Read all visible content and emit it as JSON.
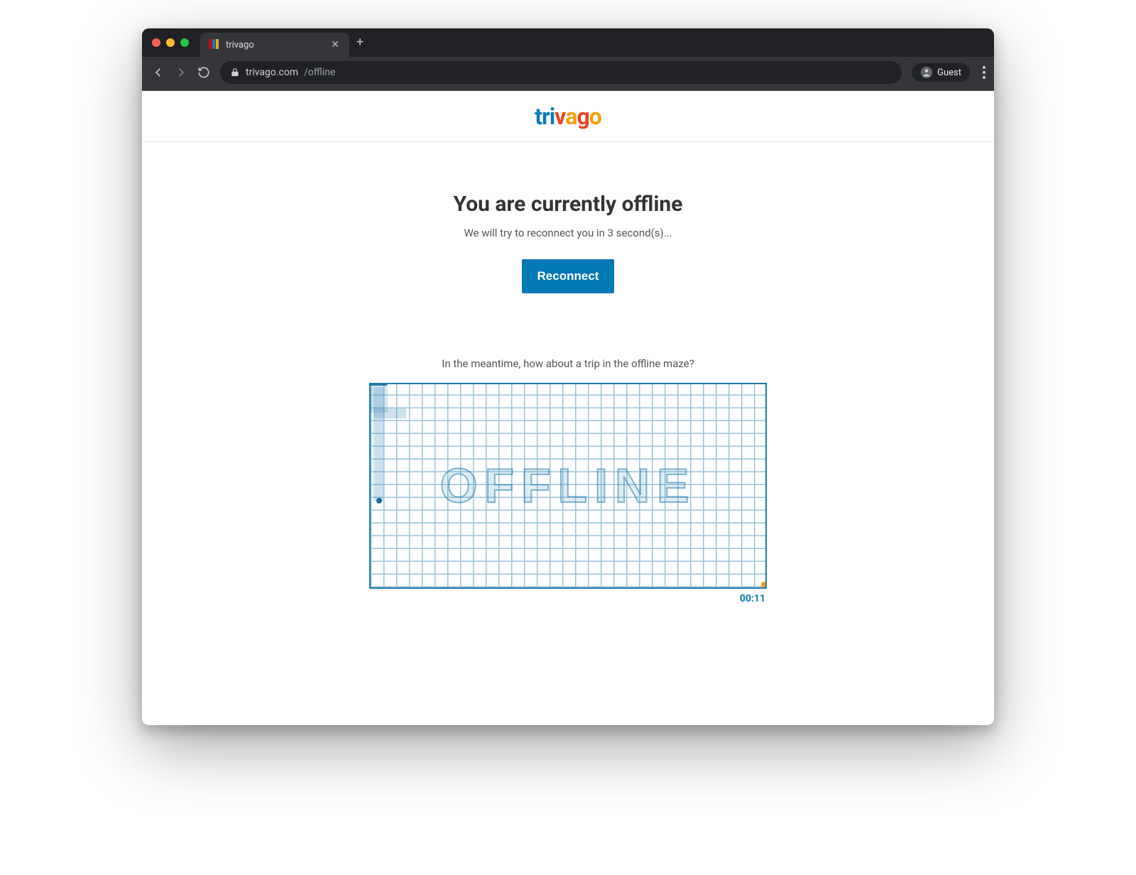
{
  "browser": {
    "tab_title": "trivago",
    "url_host": "trivago.com",
    "url_path": "/offline",
    "guest_label": "Guest"
  },
  "brand": {
    "letters": [
      "t",
      "r",
      "i",
      "v",
      "a",
      "g",
      "o"
    ]
  },
  "offline": {
    "title": "You are currently offline",
    "subtitle": "We will try to reconnect you in 3 second(s)...",
    "button_label": "Reconnect"
  },
  "game": {
    "prompt": "In the meantime, how about a trip in the offline maze?",
    "maze_word": "OFFLINE",
    "timer": "00:11"
  }
}
